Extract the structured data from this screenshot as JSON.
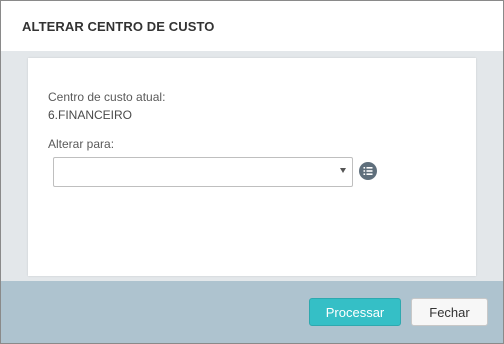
{
  "dialog": {
    "title": "ALTERAR CENTRO DE CUSTO"
  },
  "form": {
    "current_label": "Centro de custo atual:",
    "current_value": "6.FINANCEIRO",
    "change_label": "Alterar para:",
    "select_value": ""
  },
  "icons": {
    "select_arrow": "caret-down-icon",
    "list_button": "list-icon"
  },
  "footer": {
    "process_label": "Processar",
    "close_label": "Fechar"
  },
  "colors": {
    "accent": "#35bfc6",
    "footer_bg": "#aec3cf",
    "body_bg": "#e3e7ea",
    "icon_button": "#5f6f7c"
  }
}
